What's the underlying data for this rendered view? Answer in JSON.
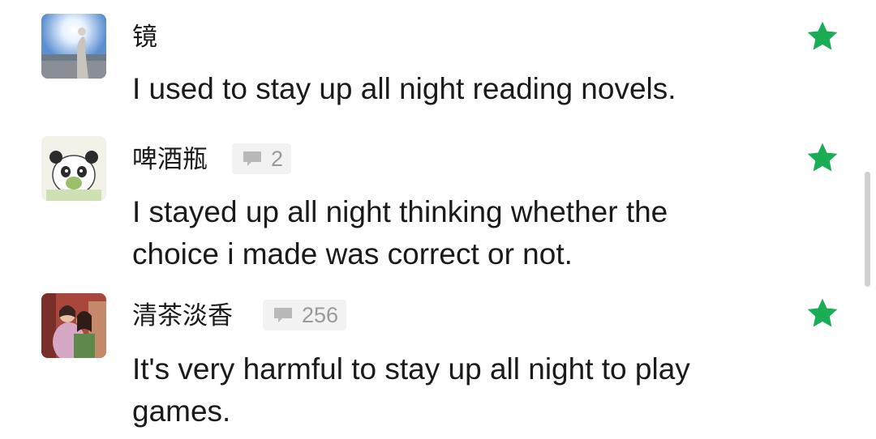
{
  "comments": [
    {
      "username": "镜",
      "reply_count": null,
      "text_lines": [
        "I used to stay up all night reading novels."
      ],
      "starred": true
    },
    {
      "username": "啤酒瓶",
      "reply_count": "2",
      "text_lines": [
        "I stayed up all night thinking whether the",
        "choice i made was correct or not."
      ],
      "starred": true
    },
    {
      "username": "清茶淡香",
      "reply_count": "256",
      "text_lines": [
        "It's very harmful to stay up all night to play",
        "games."
      ],
      "starred": true
    }
  ],
  "colors": {
    "star": "#1aad53",
    "text": "#1a1a1a",
    "badge_bg": "#f2f2f2",
    "badge_text": "#9a9a9a"
  },
  "icons": {
    "star": "star-icon",
    "reply": "comment-bubble-icon"
  }
}
